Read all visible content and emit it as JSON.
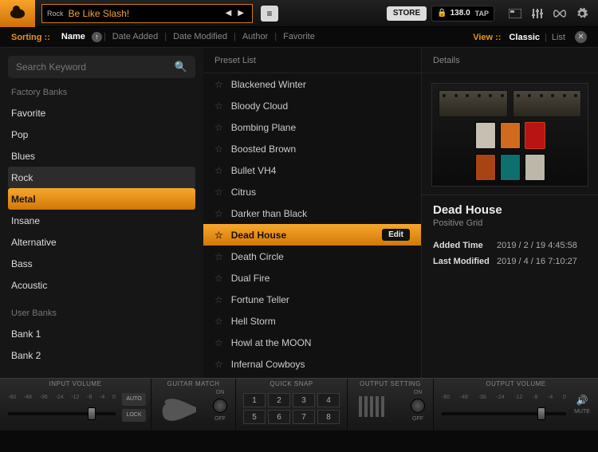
{
  "header": {
    "preset_tag": "Rock",
    "preset_name": "Be Like Slash!",
    "store_label": "STORE",
    "tempo_value": "138.0",
    "tap_label": "TAP"
  },
  "sortbar": {
    "sorting_label": "Sorting ::",
    "items": [
      "Name",
      "Date Added",
      "Date Modified",
      "Author",
      "Favorite"
    ],
    "active_sort": "Name",
    "view_label": "View ::",
    "view_items": [
      "Classic",
      "List"
    ],
    "active_view": "Classic"
  },
  "sidebar": {
    "search_placeholder": "Search Keyword",
    "factory_title": "Factory Banks",
    "factory_items": [
      "Favorite",
      "Pop",
      "Blues",
      "Rock",
      "Metal",
      "Insane",
      "Alternative",
      "Bass",
      "Acoustic"
    ],
    "dark_selected": "Rock",
    "gold_selected": "Metal",
    "user_title": "User Banks",
    "user_items": [
      "Bank 1",
      "Bank 2"
    ]
  },
  "preset_list": {
    "title": "Preset List",
    "items": [
      "Blackened Winter",
      "Bloody Cloud",
      "Bombing Plane",
      "Boosted Brown",
      "Bullet VH4",
      "Citrus",
      "Darker than Black",
      "Dead House",
      "Death Circle",
      "Dual Fire",
      "Fortune Teller",
      "Hell Storm",
      "Howl at the MOON",
      "Infernal Cowboys"
    ],
    "selected": "Dead House",
    "edit_label": "Edit"
  },
  "details": {
    "title": "Details",
    "preset_name": "Dead House",
    "author": "Positive Grid",
    "added_label": "Added Time",
    "added_value": "2019 / 2 / 19   4:45:58",
    "modified_label": "Last Modified",
    "modified_value": "2019 / 4 / 16   7:10:27"
  },
  "bottom": {
    "input_label": "INPUT VOLUME",
    "input_ticks": [
      "-60",
      "-48",
      "-36",
      "-24",
      "-12",
      "-8",
      "-4",
      "0"
    ],
    "auto_label": "AUTO",
    "lock_label": "LOCK",
    "guitar_label": "GUITAR MATCH",
    "on_label": "ON",
    "off_label": "OFF",
    "qs_label": "QUICK SNAP",
    "qs_cells": [
      "1",
      "2",
      "3",
      "4",
      "5",
      "6",
      "7",
      "8"
    ],
    "outset_label": "OUTPUT SETTING",
    "output_label": "OUTPUT VOLUME",
    "output_ticks": [
      "-60",
      "-48",
      "-36",
      "-24",
      "-12",
      "-8",
      "-4",
      "0"
    ],
    "mute_label": "MUTE"
  }
}
